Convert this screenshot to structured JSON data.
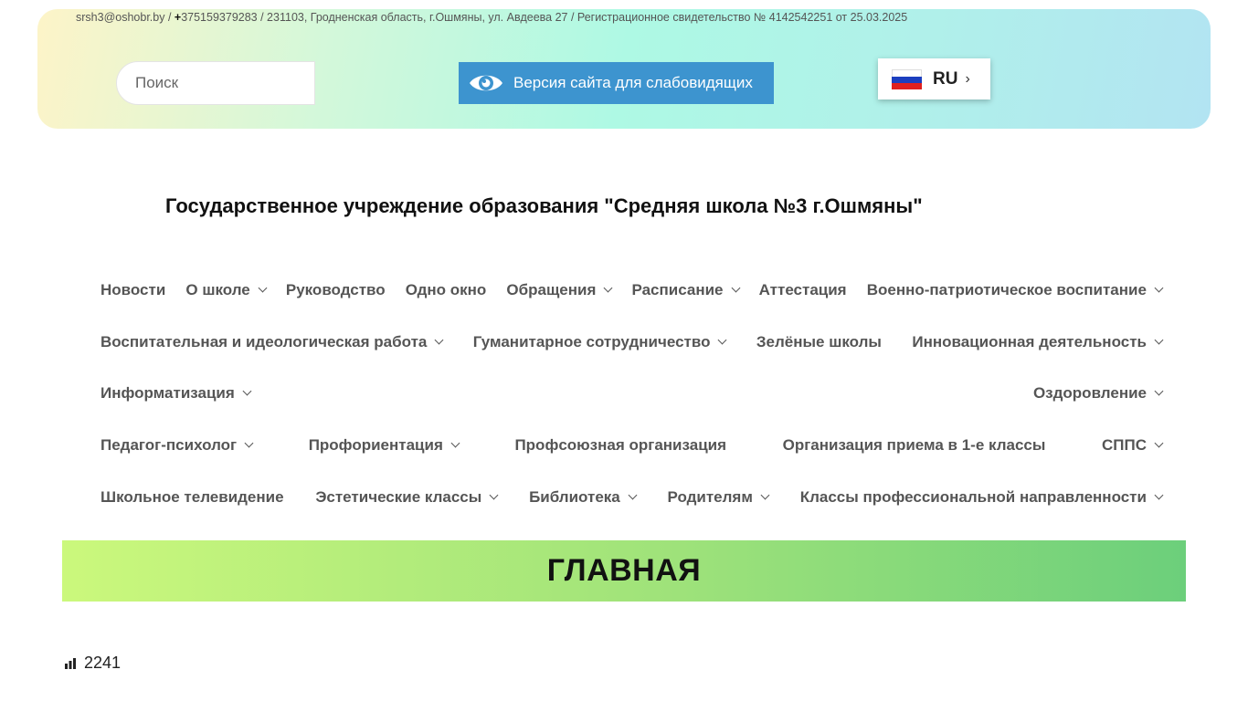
{
  "header": {
    "email": "srsh3@oshobr.by",
    "sep1": " / ",
    "phone_plus": "+",
    "phone": "375159379283",
    "address_rest": " / 231103, Гродненская область, г.Ошмяны, ул. Авдеева 27 / Регистрационное свидетельство № 4142542251 от 25.03.2025",
    "search_placeholder": "Поиск",
    "vision_label": "Версия сайта для слабовидящих",
    "lang_code": "RU",
    "colors": {
      "vision_button": "#3d94cf"
    }
  },
  "site_title": "Государственное учреждение образования \"Средняя школа №3 г.Ошмяны\"",
  "nav": {
    "rows": [
      [
        {
          "label": "Новости",
          "dropdown": false
        },
        {
          "label": "О школе",
          "dropdown": true
        },
        {
          "label": "Руководство",
          "dropdown": false
        },
        {
          "label": "Одно окно",
          "dropdown": false
        },
        {
          "label": "Обращения",
          "dropdown": true
        },
        {
          "label": "Расписание",
          "dropdown": true
        },
        {
          "label": "Аттестация",
          "dropdown": false
        },
        {
          "label": "Военно-патриотическое воспитание",
          "dropdown": true
        }
      ],
      [
        {
          "label": "Воспитательная и идеологическая работа",
          "dropdown": true
        },
        {
          "label": "Гуманитарное сотрудничество",
          "dropdown": true
        },
        {
          "label": "Зелёные школы",
          "dropdown": false
        },
        {
          "label": "Инновационная деятельность",
          "dropdown": true
        }
      ],
      [
        {
          "label": "Информатизация",
          "dropdown": true
        },
        {
          "label": "Оздоровление",
          "dropdown": true
        }
      ],
      [
        {
          "label": "Педагог-психолог",
          "dropdown": true
        },
        {
          "label": "Профориентация",
          "dropdown": true
        },
        {
          "label": "Профсоюзная организация",
          "dropdown": false
        },
        {
          "label": "Организация приема в 1-е классы",
          "dropdown": false
        },
        {
          "label": "СППС",
          "dropdown": true
        }
      ],
      [
        {
          "label": "Школьное телевидение",
          "dropdown": false
        },
        {
          "label": "Эстетические классы",
          "dropdown": true
        },
        {
          "label": "Библиотека",
          "dropdown": true
        },
        {
          "label": "Родителям",
          "dropdown": true
        },
        {
          "label": "Классы профессиональной направленности",
          "dropdown": true
        }
      ]
    ]
  },
  "page": {
    "heading": "ГЛАВНАЯ",
    "views_count": "2241"
  }
}
